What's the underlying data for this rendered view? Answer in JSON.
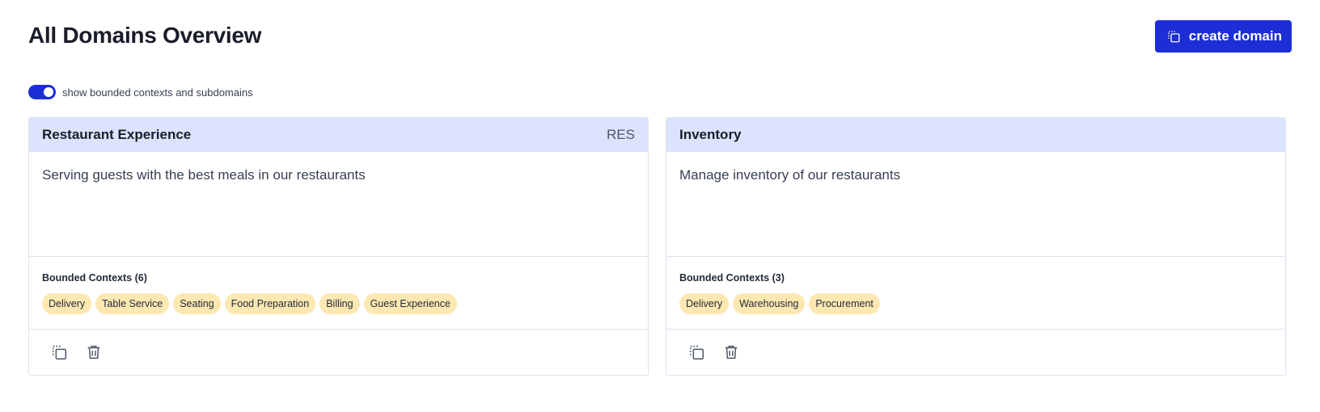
{
  "header": {
    "title": "All Domains Overview",
    "create_button_label": "create domain",
    "create_button_icon": "copy-icon"
  },
  "toggle": {
    "label": "show bounded contexts and subdomains",
    "checked": true
  },
  "colors": {
    "accent": "#1d2ed6",
    "card_header_bg": "#dde3fd",
    "chip_bg": "#fde8b2"
  },
  "domains": [
    {
      "name": "Restaurant Experience",
      "abbreviation": "RES",
      "description": "Serving guests with the best meals in our restaurants",
      "contexts_title": "Bounded Contexts (6)",
      "contexts": [
        "Delivery",
        "Table Service",
        "Seating",
        "Food Preparation",
        "Billing",
        "Guest Experience"
      ],
      "actions": [
        "copy-icon",
        "trash-icon"
      ]
    },
    {
      "name": "Inventory",
      "abbreviation": "",
      "description": "Manage inventory of our restaurants",
      "contexts_title": "Bounded Contexts (3)",
      "contexts": [
        "Delivery",
        "Warehousing",
        "Procurement"
      ],
      "actions": [
        "copy-icon",
        "trash-icon"
      ]
    }
  ]
}
